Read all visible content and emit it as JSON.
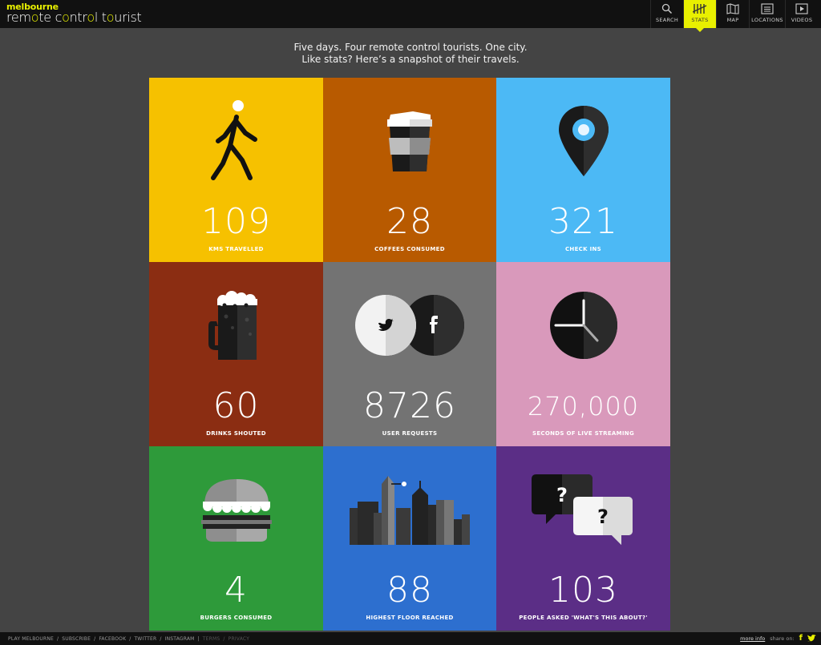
{
  "header": {
    "logo_top": "melbourne",
    "logo_bottom": [
      "rem",
      "o",
      "te c",
      "o",
      "ntr",
      "o",
      "l t",
      "o",
      "urist"
    ],
    "nav": [
      {
        "label": "SEARCH",
        "icon": "search-icon",
        "active": false
      },
      {
        "label": "STATS",
        "icon": "stats-icon",
        "active": true
      },
      {
        "label": "MAP",
        "icon": "map-icon",
        "active": false
      },
      {
        "label": "LOCATIONS",
        "icon": "list-icon",
        "active": false
      },
      {
        "label": "VIDEOS",
        "icon": "play-icon",
        "active": false
      }
    ]
  },
  "intro": {
    "line1": "Five days. Four remote control tourists. One city.",
    "line2": "Like stats? Here’s a snapshot of their travels."
  },
  "tiles": [
    {
      "value": "109",
      "caption": "KMS TRAVELLED",
      "color": "#f6c100",
      "icon": "walking-person-icon"
    },
    {
      "value": "28",
      "caption": "COFFEES CONSUMED",
      "color": "#b85a00",
      "icon": "coffee-cup-icon"
    },
    {
      "value": "321",
      "caption": "CHECK INS",
      "color": "#4cb9f5",
      "icon": "location-pin-icon"
    },
    {
      "value": "60",
      "caption": "DRINKS SHOUTED",
      "color": "#8b2d12",
      "icon": "beer-mug-icon"
    },
    {
      "value": "8726",
      "caption": "USER REQUESTS",
      "color": "#737373",
      "icon": "twitter-facebook-icon"
    },
    {
      "value": "270,000",
      "caption": "SECONDS OF LIVE STREAMING",
      "color": "#d999bb",
      "icon": "clock-icon"
    },
    {
      "value": "4",
      "caption": "BURGERS CONSUMED",
      "color": "#2e9a3a",
      "icon": "burger-icon"
    },
    {
      "value": "88",
      "caption": "HIGHEST FLOOR REACHED",
      "color": "#2d6fcf",
      "icon": "city-skyline-icon"
    },
    {
      "value": "103",
      "caption": "PEOPLE ASKED 'WHAT'S THIS ABOUT?'",
      "color": "#5b2e86",
      "icon": "question-bubbles-icon"
    }
  ],
  "footer": {
    "links": [
      "PLAY MELBOURNE",
      "SUBSCRIBE",
      "FACEBOOK",
      "TWITTER",
      "INSTAGRAM"
    ],
    "dim_links": [
      "TERMS",
      "PRIVACY"
    ],
    "more_info": "more info",
    "share_on": "share on:",
    "share_icons": [
      "f",
      "t"
    ]
  }
}
